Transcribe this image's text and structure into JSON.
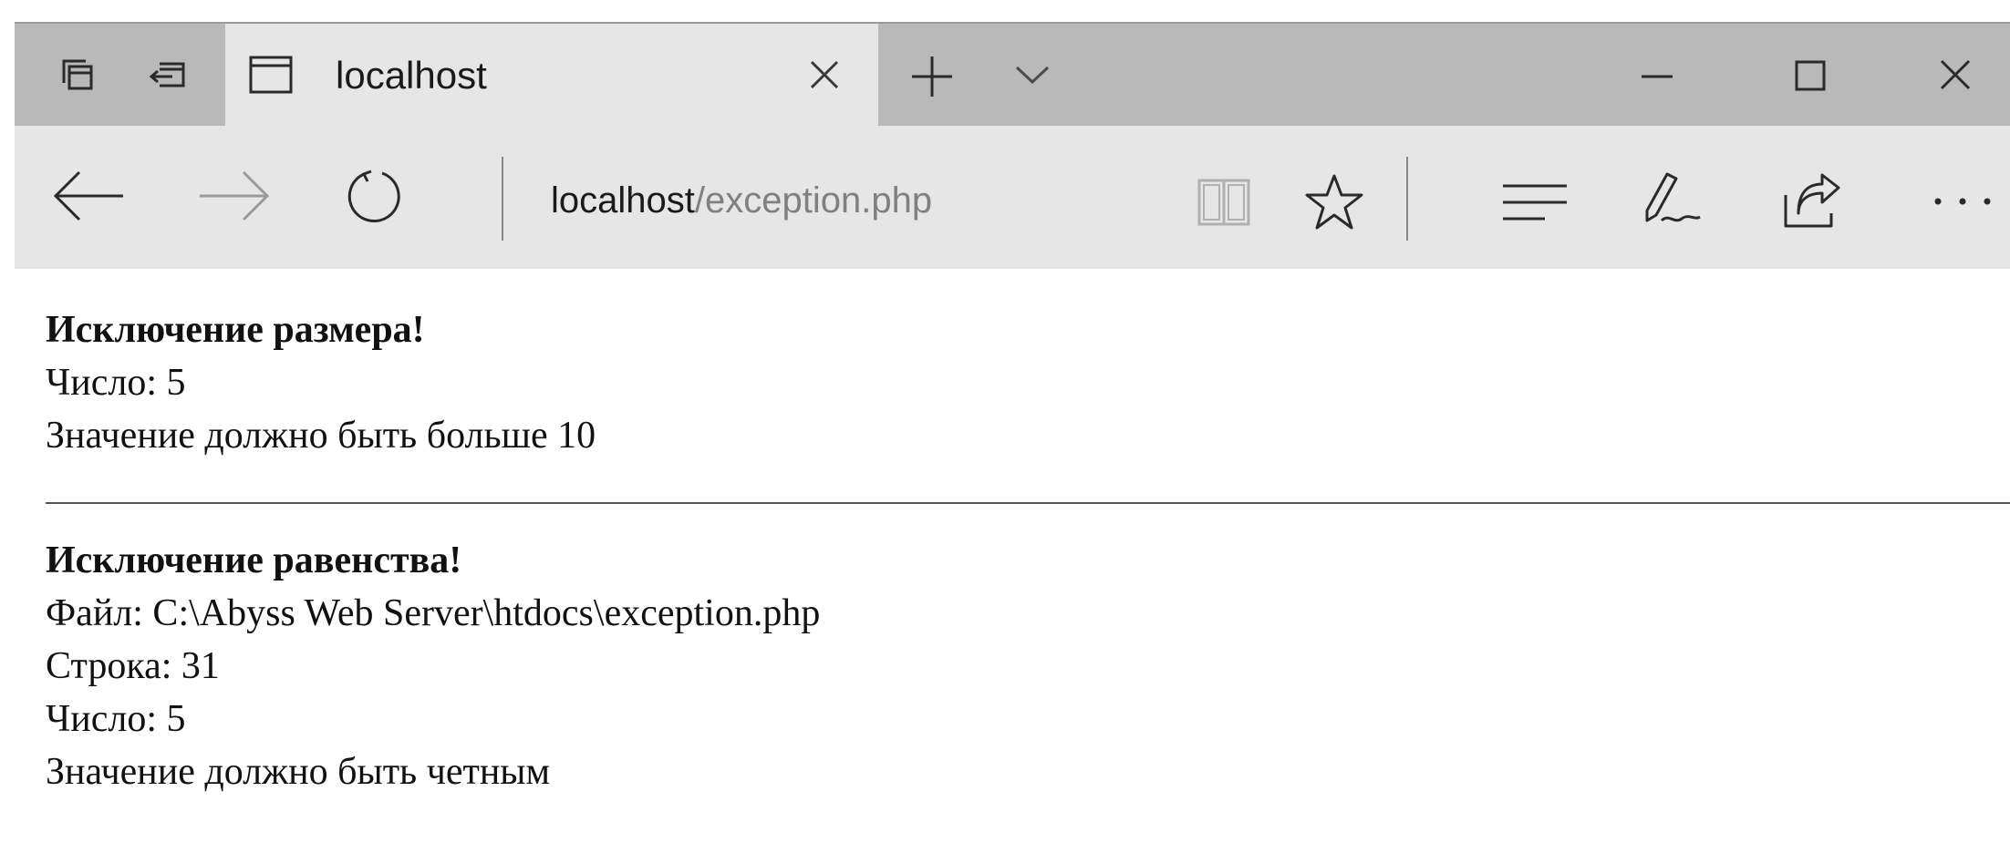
{
  "browser": {
    "tab": {
      "title": "localhost"
    },
    "address": {
      "host": "localhost",
      "path": "/exception.php"
    },
    "icons": {
      "tab_preview": "tab-preview-icon",
      "set_aside": "set-aside-tabs-icon",
      "page": "page-icon",
      "close_tab": "close-icon",
      "new_tab": "plus-icon",
      "tab_list": "chevron-down-icon",
      "minimize": "minimize-icon",
      "maximize": "maximize-icon",
      "close_window": "close-window-icon",
      "back": "back-arrow-icon",
      "forward": "forward-arrow-icon",
      "refresh": "refresh-icon",
      "reading_view": "book-icon",
      "favorite": "star-icon",
      "hub": "hub-icon",
      "notes": "pen-icon",
      "share": "share-icon",
      "more": "more-icon"
    }
  },
  "content": {
    "block1": {
      "heading": "Исключение размера!",
      "lines": [
        "Число: 5",
        "Значение должно быть больше 10"
      ]
    },
    "block2": {
      "heading": "Исключение равенства!",
      "lines": [
        "Файл: C:\\Abyss Web Server\\htdocs\\exception.php",
        "Строка: 31",
        "Число: 5",
        "Значение должно быть четным"
      ]
    }
  }
}
